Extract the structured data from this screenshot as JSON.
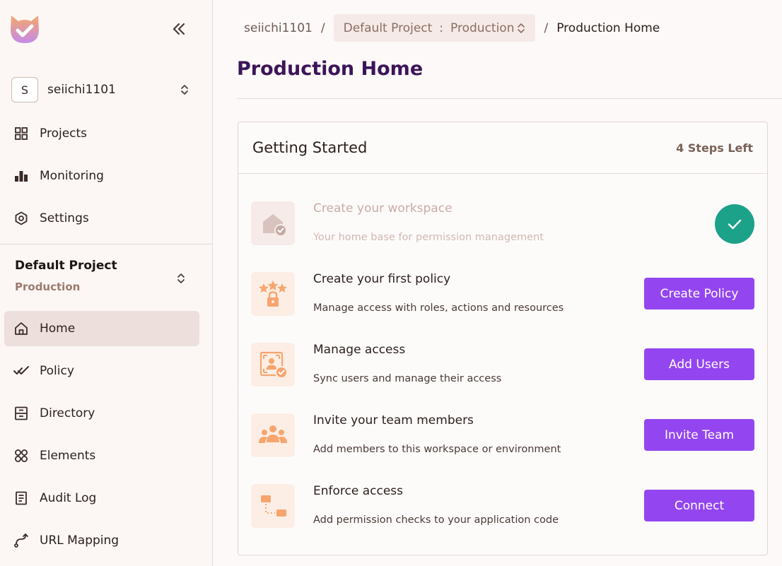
{
  "sidebar": {
    "org": {
      "initial": "S",
      "name": "seiichi1101"
    },
    "top_nav": [
      {
        "label": "Projects",
        "icon": "grid-icon"
      },
      {
        "label": "Monitoring",
        "icon": "bar-chart-icon"
      },
      {
        "label": "Settings",
        "icon": "gear-icon"
      }
    ],
    "project": {
      "name": "Default Project",
      "environment": "Production"
    },
    "project_nav": [
      {
        "label": "Home",
        "icon": "home-icon",
        "active": true
      },
      {
        "label": "Policy",
        "icon": "double-check-icon"
      },
      {
        "label": "Directory",
        "icon": "directory-icon"
      },
      {
        "label": "Elements",
        "icon": "elements-icon"
      },
      {
        "label": "Audit Log",
        "icon": "document-icon"
      },
      {
        "label": "URL Mapping",
        "icon": "route-icon"
      }
    ]
  },
  "breadcrumb": {
    "org": "seiichi1101",
    "separator": "/",
    "project": "Default Project",
    "colon": ":",
    "environment": "Production",
    "current": "Production Home"
  },
  "page": {
    "title": "Production Home"
  },
  "getting_started": {
    "title": "Getting Started",
    "steps_left": "4 Steps Left",
    "steps": [
      {
        "title": "Create your workspace",
        "description": "Your home base for permission management",
        "completed": true,
        "icon": "house-check-icon"
      },
      {
        "title": "Create your first policy",
        "description": "Manage access with roles, actions and resources",
        "button": "Create Policy",
        "icon": "stars-lock-icon"
      },
      {
        "title": "Manage access",
        "description": "Sync users and manage their access",
        "button": "Add Users",
        "icon": "user-frame-check-icon"
      },
      {
        "title": "Invite your team members",
        "description": "Add members to this workspace or environment",
        "button": "Invite Team",
        "icon": "team-icon"
      },
      {
        "title": "Enforce access",
        "description": "Add permission checks to your application code",
        "button": "Connect",
        "icon": "flow-icon"
      }
    ]
  },
  "colors": {
    "accent": "#9346f0",
    "success": "#1ba289",
    "title": "#3d1459",
    "icon_bg": "#fdeee5",
    "icon_fg": "#f7a56e"
  }
}
